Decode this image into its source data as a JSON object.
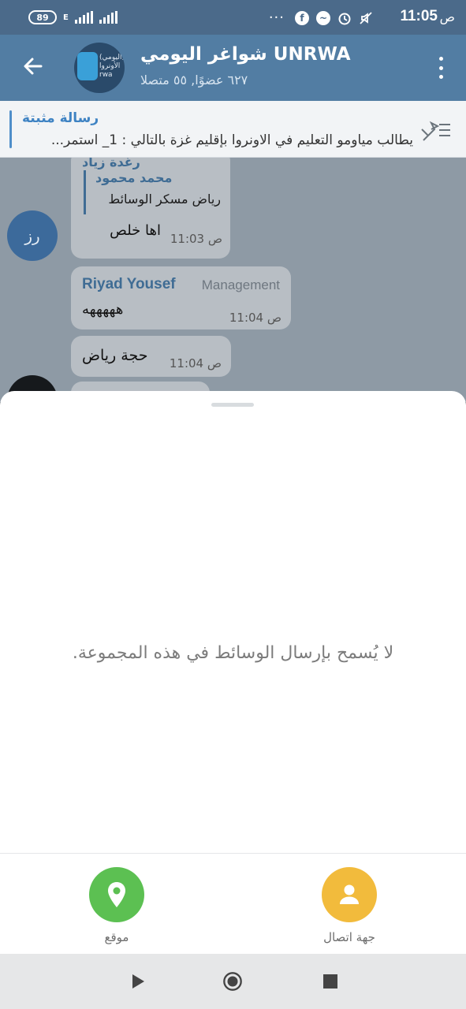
{
  "status_bar": {
    "time": "11:05",
    "ampm": "ص",
    "battery": "89",
    "network": "E",
    "icons": [
      "facebook-icon",
      "messenger-icon",
      "alarm-icon",
      "mute-icon"
    ],
    "more": "···"
  },
  "header": {
    "title": "شواغر اليومي UNRWA",
    "subtitle": "٦٢٧ عضوًا, ٥٥ متصلا",
    "avatar_text_1": "(اليومي)",
    "avatar_text_2": "الأونروا",
    "avatar_text_3": "rwa"
  },
  "pinned": {
    "title": "رسالة مثبتة",
    "text": "يطالب مياومو التعليم في الاونروا بإقليم غزة بالتالي :  1_ استمر..."
  },
  "chat": {
    "messages": [
      {
        "sender": "رغدة زياد",
        "reply_name": "محمد محمود",
        "reply_text": "رياض مسكر الوسائط",
        "text": "اها خلص",
        "time": "11:03 ص",
        "avatar_initials": "رز"
      },
      {
        "sender": "Riyad Yousef",
        "role": "Management",
        "text": "هههههه",
        "time": "11:04 ص"
      },
      {
        "text": "حجة رياض",
        "time": "11:04 ص"
      }
    ]
  },
  "sheet": {
    "notice": "لا يُسمح بإرسال الوسائط في هذه المجموعة.",
    "location_label": "موقع",
    "contact_label": "جهة اتصال"
  },
  "colors": {
    "header": "#527da3",
    "status_bar": "#4b6a8a",
    "location": "#5cc052",
    "contact": "#f2bb3c"
  }
}
